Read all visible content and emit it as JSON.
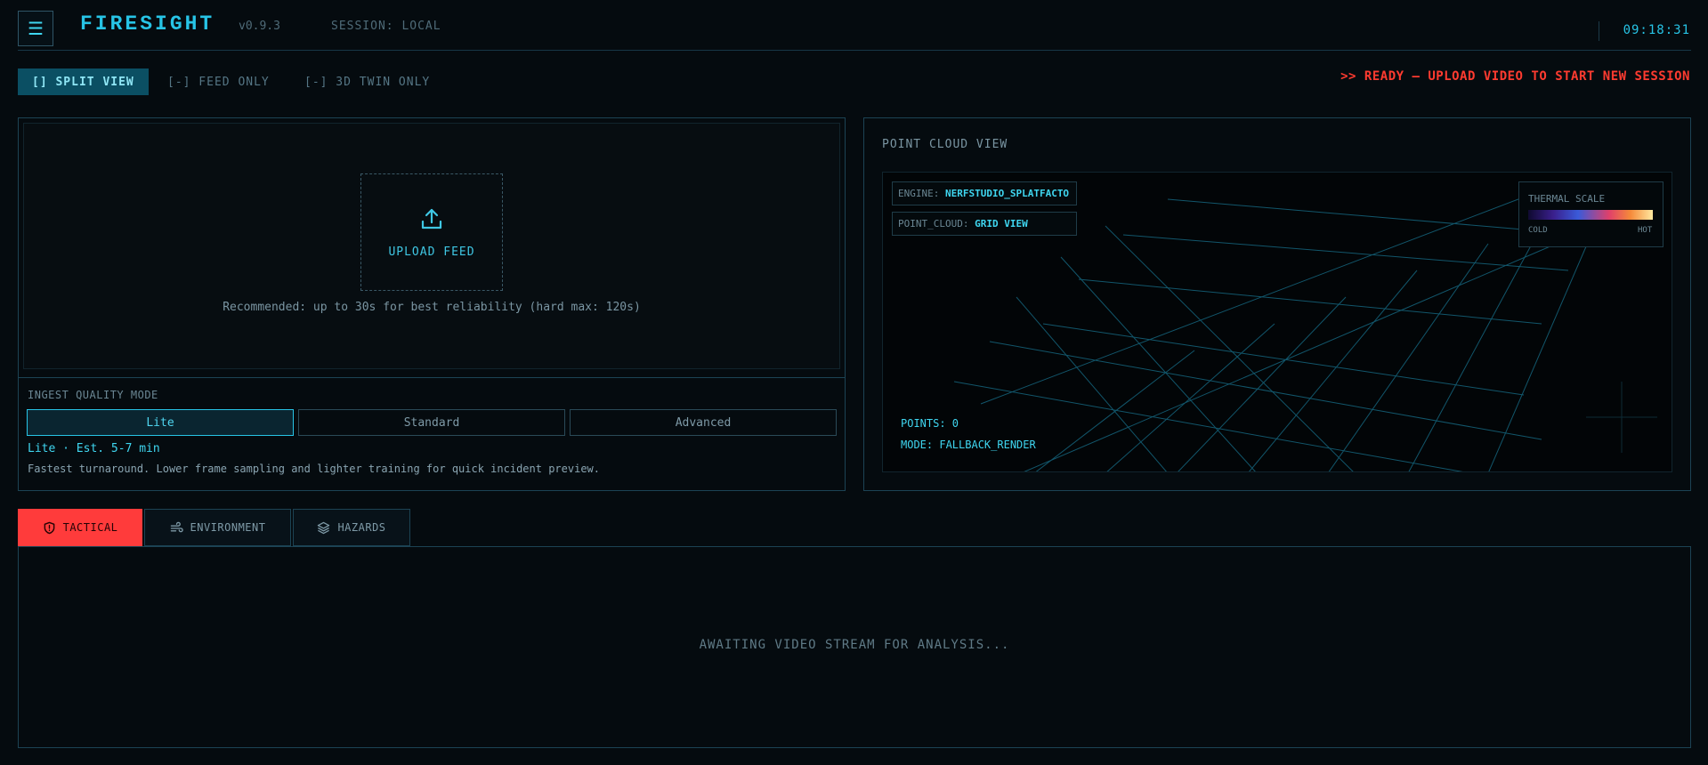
{
  "header": {
    "menu_icon": "hamburger-icon",
    "title": "FIRESIGHT",
    "version": "v0.9.3",
    "session": "SESSION: LOCAL",
    "clock": "09:18:31"
  },
  "view_tabs": {
    "split": "[] SPLIT VIEW",
    "feed": "[-] FEED ONLY",
    "twin": "[-] 3D TWIN ONLY",
    "active": "split"
  },
  "status_message": ">> READY — UPLOAD VIDEO TO START NEW SESSION",
  "upload": {
    "icon": "upload-icon",
    "label": "UPLOAD FEED",
    "hint": "Recommended: up to 30s for best reliability (hard max: 120s)"
  },
  "quality": {
    "title": "INGEST QUALITY MODE",
    "modes": [
      "Lite",
      "Standard",
      "Advanced"
    ],
    "selected": "Lite",
    "estimate": "Lite · Est. 5-7 min",
    "description": "Fastest turnaround. Lower frame sampling and lighter training for quick incident preview."
  },
  "point_cloud": {
    "title": "POINT CLOUD VIEW",
    "engine_key": "ENGINE:",
    "engine_value": "NERFSTUDIO_SPLATFACTO",
    "pc_key": "POINT_CLOUD:",
    "pc_value": "GRID VIEW",
    "thermal_title": "THERMAL SCALE",
    "thermal_cold": "COLD",
    "thermal_hot": "HOT",
    "points": "POINTS: 0",
    "mode": "MODE: FALLBACK_RENDER"
  },
  "analysis_tabs": {
    "tactical": "TACTICAL",
    "environment": "ENVIRONMENT",
    "hazards": "HAZARDS",
    "active": "tactical"
  },
  "analysis": {
    "placeholder": "AWAITING VIDEO STREAM FOR ANALYSIS..."
  },
  "colors": {
    "accent": "#27c4e6",
    "alert": "#ff3b30",
    "background": "#050b0f",
    "border": "#1c4354"
  }
}
